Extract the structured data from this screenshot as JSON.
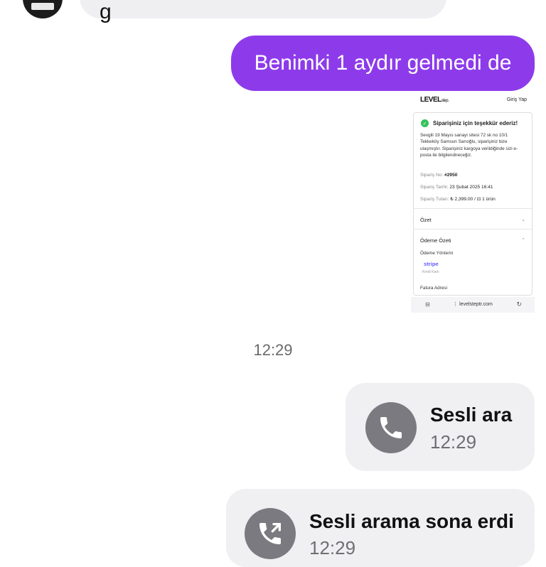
{
  "previous_message": {
    "fragment": "g"
  },
  "outgoing_text_message": "Benimki 1 aydır gelmedi de",
  "screenshot_preview": {
    "brand": "LEVEL",
    "brand_suffix": "step.",
    "login_label": "Giriş Yap",
    "success_title": "Siparişiniz için teşekkür ederiz!",
    "body_text": "Sevgili 19 Mayıs sanayi sitesi 72 sk no 10/1 Tekkeköy Samsun Sarıoğlu, siparişiniz bize ulaşmıştır. Siparişiniz kargoya verildiğinde sizi e-posta ile bilgilendireceğiz.",
    "order_no_label": "Sipariş No:",
    "order_no": "#2950",
    "order_date_label": "Sipariş Tarihi:",
    "order_date": "23 Şubat 2025 16:41",
    "order_total_label": "Sipariş Tutarı:",
    "order_total": "₺ 2,399.00",
    "order_items": "1 ürün",
    "summary_label": "Özet",
    "payment_summary_label": "Ödeme Özeti",
    "payment_method_label": "Ödeme Yöntemi",
    "payment_provider": "stripe",
    "payment_type": "Kredi Kartı",
    "billing_address_label": "Fatura Adresi",
    "url": "levelsteptr.com"
  },
  "timestamp": "12:29",
  "calls": [
    {
      "title": "Sesli ara",
      "time": "12:29"
    },
    {
      "title": "Sesli arama sona erdi",
      "time": "12:29"
    }
  ]
}
